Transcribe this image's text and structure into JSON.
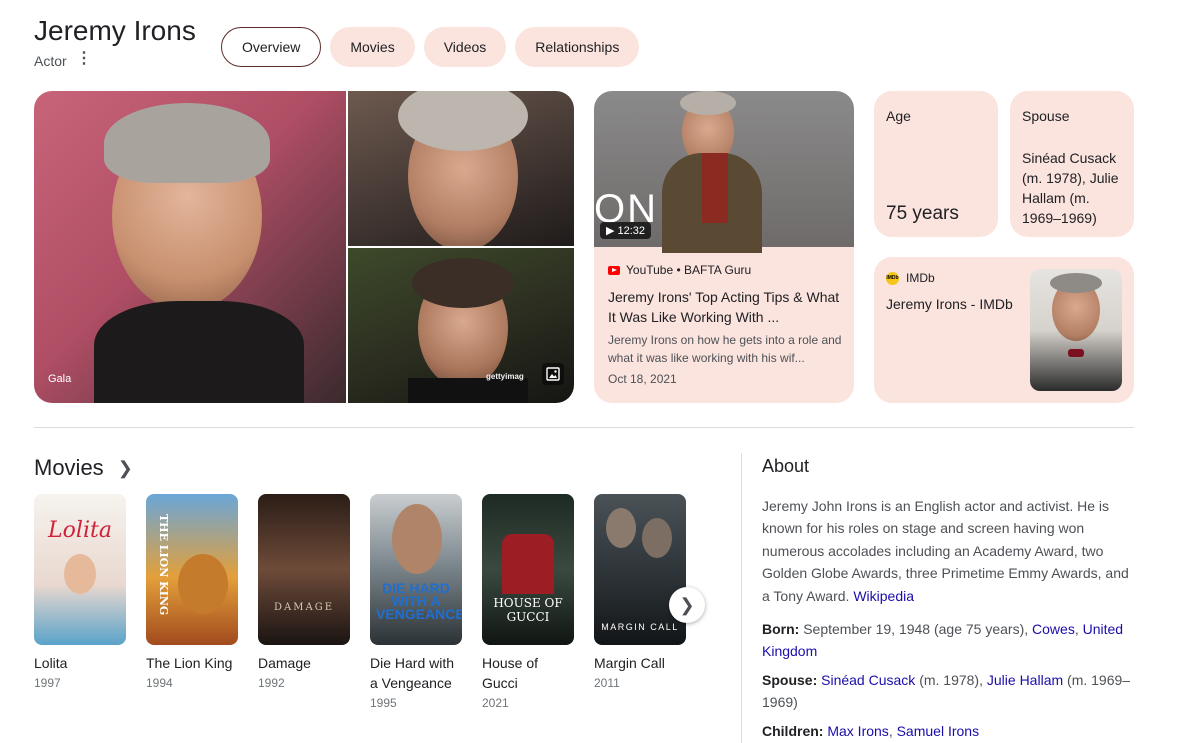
{
  "header": {
    "name": "Jeremy Irons",
    "subtitle": "Actor",
    "tabs": [
      {
        "label": "Overview",
        "active": true
      },
      {
        "label": "Movies"
      },
      {
        "label": "Videos"
      },
      {
        "label": "Relationships"
      }
    ]
  },
  "gallery": {
    "main_caption": "Gala",
    "getty": "gettyimag"
  },
  "video": {
    "duration": "12:32",
    "thumb_text": "ON",
    "source": "YouTube • BAFTA Guru",
    "title": "Jeremy Irons' Top Acting Tips & What It Was Like Working With ...",
    "description": "Jeremy Irons on how he gets into a role and what it was like working with his wif...",
    "date": "Oct 18, 2021"
  },
  "facts": {
    "age_label": "Age",
    "age_value": "75 years",
    "spouse_label": "Spouse",
    "spouse_value": "Sinéad Cusack (m. 1978), Julie Hallam (m. 1969–1969)"
  },
  "imdb": {
    "source": "IMDb",
    "title": "Jeremy Irons - IMDb"
  },
  "movies": {
    "heading": "Movies",
    "items": [
      {
        "title": "Lolita",
        "year": "1997",
        "poster_text": "Lolita"
      },
      {
        "title": "The Lion King",
        "year": "1994",
        "poster_text": "THE LION KING"
      },
      {
        "title": "Damage",
        "year": "1992",
        "poster_text": "DAMAGE"
      },
      {
        "title": "Die Hard with a Vengeance",
        "year": "1995",
        "poster_text": "DIE HARD WITH A VENGEANCE"
      },
      {
        "title": "House of Gucci",
        "year": "2021",
        "poster_text": "HOUSE OF GUCCI"
      },
      {
        "title": "Margin Call",
        "year": "2011",
        "poster_text": "MARGIN CALL"
      }
    ]
  },
  "about": {
    "heading": "About",
    "text": "Jeremy John Irons is an English actor and activist. He is known for his roles on stage and screen having won numerous accolades including an Academy Award, two Golden Globe Awards, three Primetime Emmy Awards, and a Tony Award.",
    "source_link": "Wikipedia",
    "born_label": "Born:",
    "born_text": "September 19, 1948 (age 75 years),",
    "born_link1": "Cowes",
    "born_link2": "United Kingdom",
    "spouse_label": "Spouse:",
    "spouse_link1": "Sinéad Cusack",
    "spouse_mid": "(m. 1978),",
    "spouse_link2": "Julie Hallam",
    "spouse_end": "(m. 1969–1969)",
    "children_label": "Children:",
    "children_link1": "Max Irons",
    "children_link2": "Samuel Irons"
  },
  "colors": {
    "card_bg": "#fbe3de",
    "link": "#1a0dab",
    "tab_active_border": "#5c2b29"
  }
}
